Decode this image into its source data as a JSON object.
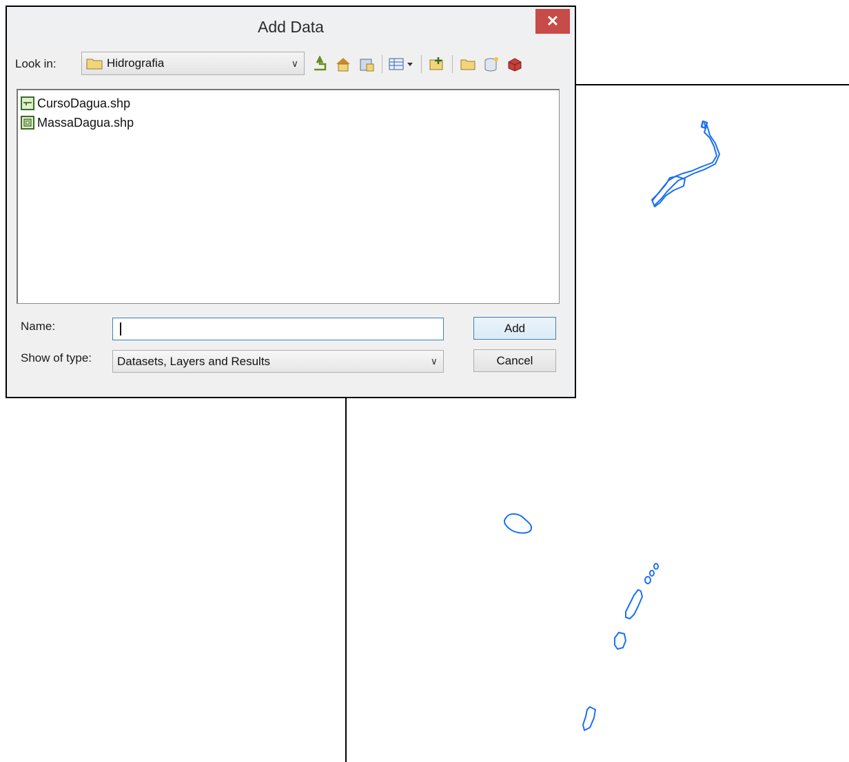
{
  "dialog": {
    "title": "Add Data",
    "close_label": "✕",
    "look_in_label": "Look in:",
    "look_in_value": "Hidrografia",
    "files": [
      {
        "name": "CursoDagua.shp",
        "icon": "line-shapefile-icon"
      },
      {
        "name": "MassaDagua.shp",
        "icon": "polygon-shapefile-icon"
      }
    ],
    "name_label": "Name:",
    "name_value": "",
    "type_label": "Show of type:",
    "type_value": "Datasets, Layers and Results",
    "add_label": "Add",
    "cancel_label": "Cancel"
  },
  "toolbar_icons": [
    "up-one-level-icon",
    "home-folder-icon",
    "connect-folder-icon",
    "view-list-icon",
    "new-layer-icon",
    "new-folder-icon",
    "new-geodatabase-icon",
    "toolbox-icon"
  ],
  "colors": {
    "feature_stroke": "#1a6ef5",
    "close_button": "#c74b48",
    "dialog_bg": "#f0f0f0"
  }
}
